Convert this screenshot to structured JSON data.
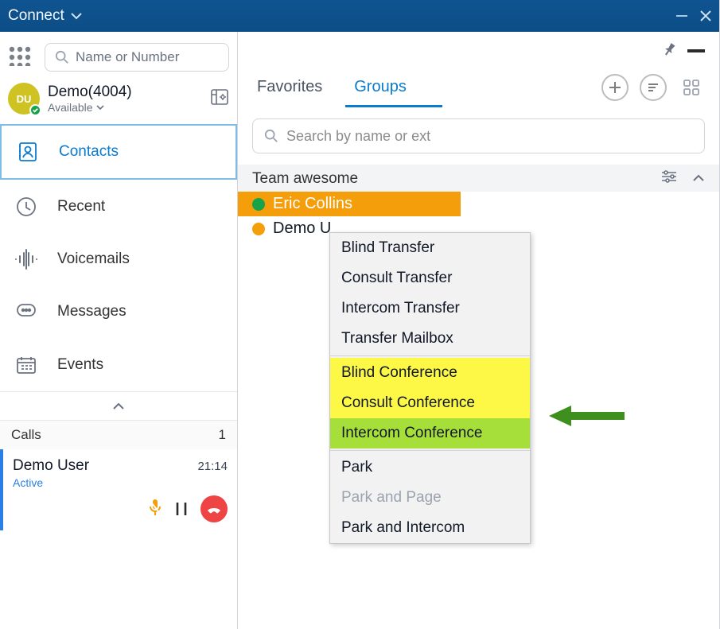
{
  "titlebar": {
    "title": "Connect"
  },
  "left": {
    "search_placeholder": "Name or Number",
    "user": {
      "avatar_text": "DU",
      "name": "Demo(4004)",
      "status": "Available"
    },
    "nav": {
      "contacts": "Contacts",
      "recent": "Recent",
      "voicemails": "Voicemails",
      "messages": "Messages",
      "events": "Events"
    },
    "calls": {
      "label": "Calls",
      "count": "1"
    },
    "call": {
      "name": "Demo User",
      "time": "21:14",
      "status": "Active"
    }
  },
  "right": {
    "tabs": {
      "favorites": "Favorites",
      "groups": "Groups"
    },
    "search_placeholder": "Search by name or ext",
    "group": {
      "name": "Team awesome"
    },
    "members": [
      {
        "name": "Eric Collins",
        "presence": "green",
        "selected": true
      },
      {
        "name": "Demo U",
        "presence": "orange",
        "selected": false
      }
    ],
    "context_menu": {
      "items": [
        {
          "label": "Blind Transfer",
          "style": "normal"
        },
        {
          "label": "Consult Transfer",
          "style": "normal"
        },
        {
          "label": "Intercom Transfer",
          "style": "normal"
        },
        {
          "label": "Transfer Mailbox",
          "style": "normal"
        },
        {
          "label": "Blind Conference",
          "style": "yhi"
        },
        {
          "label": "Consult Conference",
          "style": "yhi"
        },
        {
          "label": "Intercom Conference",
          "style": "ghi"
        },
        {
          "label": "Park",
          "style": "normal"
        },
        {
          "label": "Park and Page",
          "style": "disabled"
        },
        {
          "label": "Park and Intercom",
          "style": "normal"
        }
      ]
    }
  }
}
